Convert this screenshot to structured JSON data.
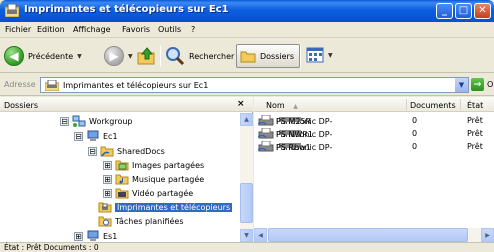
{
  "window": {
    "title": "Imprimantes et télécopieurs sur Ec1",
    "min": "_",
    "max": "□",
    "close": "✕"
  },
  "menu": [
    {
      "label": "Fichier"
    },
    {
      "label": "Edition"
    },
    {
      "label": "Affichage"
    },
    {
      "label": "Favoris"
    },
    {
      "label": "Outils"
    },
    {
      "label": "?"
    }
  ],
  "toolbar": {
    "back_label": "Précédente",
    "search_label": "Rechercher",
    "folders_label": "Dossiers"
  },
  "address": {
    "label": "Adresse",
    "value": "Imprimantes et télécopieurs sur Ec1",
    "go_label": "OK"
  },
  "folders_pane": {
    "title": "Dossiers",
    "close": "×",
    "tree": [
      {
        "label": "Workgroup",
        "icon": "network-icon",
        "expander": "⊟"
      },
      {
        "label": "Ec1",
        "icon": "computer-icon",
        "expander": "⊟"
      },
      {
        "label": "SharedDocs",
        "icon": "shared-folder-icon",
        "expander": "⊟"
      },
      {
        "label": "Images partagées",
        "icon": "images-folder-icon",
        "expander": "⊞"
      },
      {
        "label": "Musique partagée",
        "icon": "music-folder-icon",
        "expander": "⊞"
      },
      {
        "label": "Vidéo partagée",
        "icon": "video-folder-icon",
        "expander": "⊞"
      },
      {
        "label": "Imprimantes et télécopieurs",
        "icon": "printers-folder-icon",
        "expander": ""
      },
      {
        "label": "Tâches planifiées",
        "icon": "tasks-folder-icon",
        "expander": ""
      },
      {
        "label": "Es1",
        "icon": "computer-icon",
        "expander": "⊞"
      }
    ]
  },
  "files_pane": {
    "columns": {
      "name": "Nom",
      "sort": "▲",
      "documents": "Documents",
      "state": "État"
    },
    "rows": [
      {
        "name_prefix": "Panasonic DP-",
        "name_suffix": "PS M25R",
        "documents": "0",
        "state": "Prêt"
      },
      {
        "name_prefix": "Panasonic DP-",
        "name_suffix": "PS NWR1",
        "documents": "0",
        "state": "Prêt"
      },
      {
        "name_prefix": "Panasonic DP-",
        "name_suffix": "PS Rbw1",
        "documents": "0",
        "state": "Prêt"
      }
    ]
  },
  "status": {
    "text": "État : Prêt Documents : 0"
  },
  "colors": {
    "title_blue": "#0a5ad8",
    "selection_blue": "#316ac5",
    "chrome": "#ece9d8"
  }
}
